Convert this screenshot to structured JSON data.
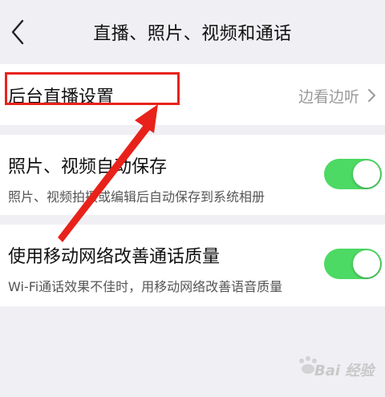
{
  "header": {
    "title": "直播、照片、视频和通话",
    "back_icon": "chevron-left-icon"
  },
  "live_background": {
    "title": "后台直播设置",
    "value": "边看边听",
    "chevron_icon": "chevron-right-icon"
  },
  "auto_save": {
    "title": "照片、视频自动保存",
    "subtitle": "照片、视频拍摄或编辑后自动保存到系统相册",
    "enabled": true
  },
  "mobile_call": {
    "title": "使用移动网络改善通话质量",
    "subtitle": "Wi-Fi通话效果不佳时，用移动网络改善语音质量",
    "enabled": true
  },
  "annotation": {
    "box_color": "#e8221b",
    "arrow_color": "#e8221b"
  },
  "colors": {
    "background": "#efeff4",
    "toggle_on": "#4cd964",
    "secondary_text": "#9a9a9a"
  },
  "watermark": {
    "text": "Bai 经验"
  }
}
